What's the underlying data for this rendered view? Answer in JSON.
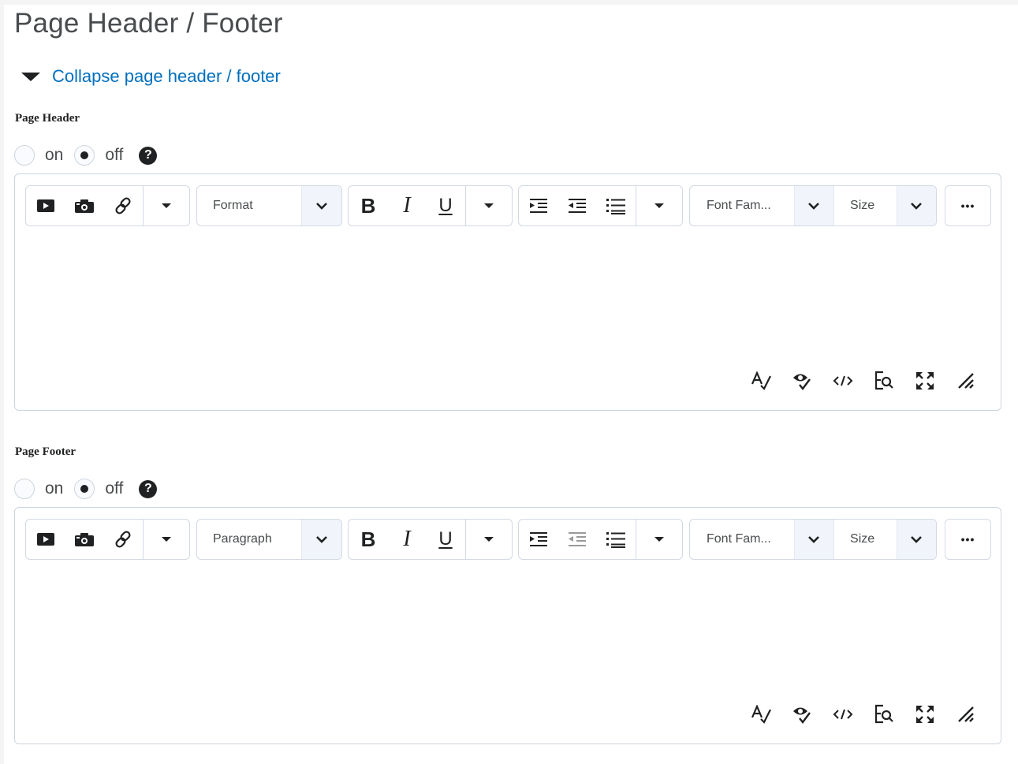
{
  "page_title": "Page Header / Footer",
  "collapse_link": "Collapse page header / footer",
  "sections": [
    {
      "label": "Page Header",
      "radio_on": "on",
      "radio_off": "off",
      "selected": "off",
      "format_select": "Format",
      "font_family_select": "Font Fam...",
      "size_select": "Size"
    },
    {
      "label": "Page Footer",
      "radio_on": "on",
      "radio_off": "off",
      "selected": "off",
      "format_select": "Paragraph",
      "font_family_select": "Font Fam...",
      "size_select": "Size"
    }
  ],
  "toolbar": {
    "bold": "B",
    "italic": "I",
    "underline": "U",
    "more": "•••",
    "help_glyph": "?"
  },
  "icons": {
    "video": "video-icon",
    "camera": "camera-icon",
    "link": "link-icon",
    "spellcheck": "spellcheck-icon",
    "accessibility": "accessibility-check-icon",
    "source_code": "source-code-icon",
    "find_replace": "find-replace-icon",
    "fullscreen": "fullscreen-icon",
    "resize": "resize-handle-icon"
  },
  "colors": {
    "link": "#006fbf",
    "text": "#494c4e",
    "border": "#cdd5dc"
  }
}
